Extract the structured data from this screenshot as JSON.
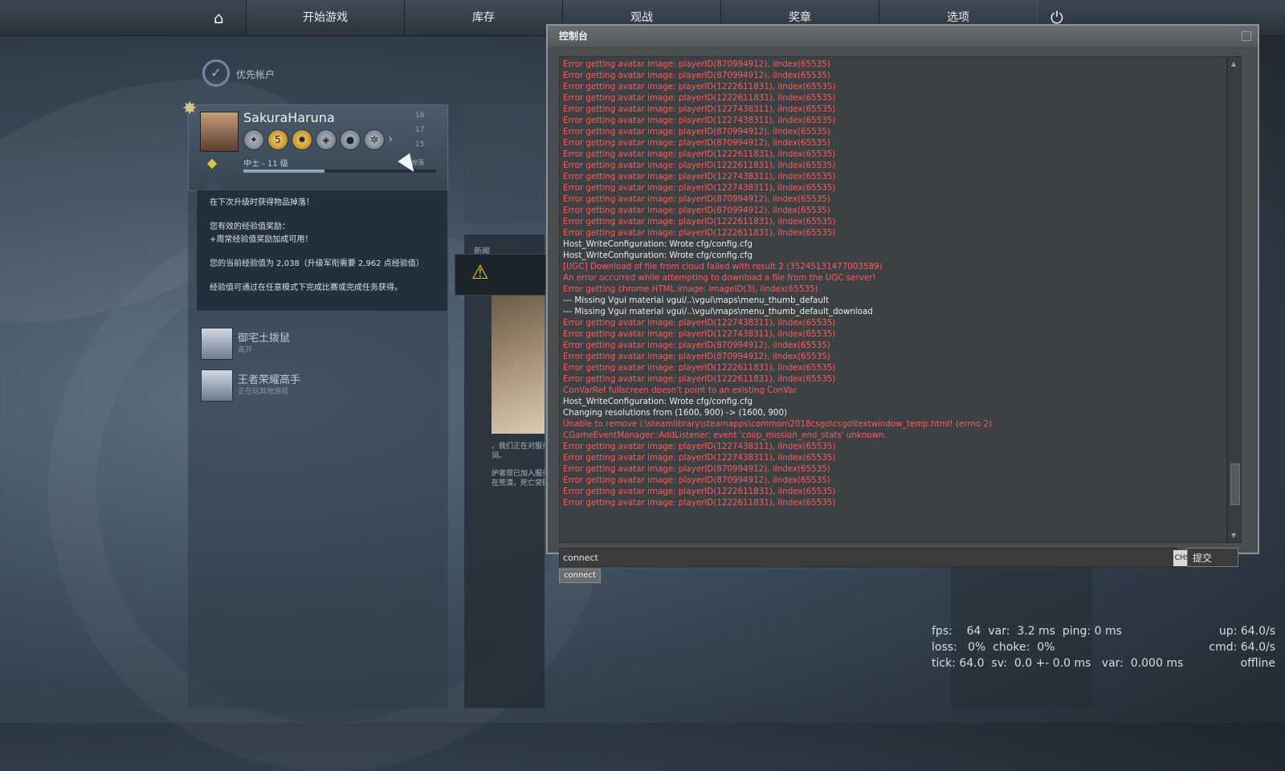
{
  "nav": {
    "items": [
      "开始游戏",
      "库存",
      "观战",
      "奖章",
      "选项"
    ]
  },
  "prime": {
    "label": "优先帐户"
  },
  "profile": {
    "username": "SakuraHaruna",
    "medal_number": "5",
    "stats": [
      "16",
      "17",
      "15"
    ],
    "rank": "中士 - 11 级",
    "xp_fraction": 0.42,
    "xp_right_label": "+ 掉落"
  },
  "tooltip": {
    "line1": "在下次升级时获得物品掉落！",
    "line2": "您有效的经验值奖励：",
    "line3": "+周常经验值奖励加成可用！",
    "line4": "您的当前经验值为 2,038（升级军衔需要 2,962 点经验值）",
    "line5": "经验值可通过在任意模式下完成比赛或完成任务获得。"
  },
  "friends": [
    {
      "name": "御宅土拨鼠",
      "status": "离开"
    },
    {
      "name": "王者荣耀高手",
      "status": "正在玩其他游戏"
    }
  ],
  "news": {
    "label": "新闻",
    "text1": "，我们正在对服务",
    "text2": "词。",
    "text3": "护者现已加入服务",
    "text4": "在荒漠，死亡突破"
  },
  "console": {
    "title": "控制台",
    "lines": [
      {
        "t": "Error getting avatar image: playerID(870994912), iIndex(65535)",
        "c": "red"
      },
      {
        "t": "Error getting avatar image: playerID(870994912), iIndex(65535)",
        "c": "red"
      },
      {
        "t": "Error getting avatar image: playerID(1222611831), iIndex(65535)",
        "c": "red"
      },
      {
        "t": "Error getting avatar image: playerID(1222611831), iIndex(65535)",
        "c": "red"
      },
      {
        "t": "Error getting avatar image: playerID(1227438311), iIndex(65535)",
        "c": "red"
      },
      {
        "t": "Error getting avatar image: playerID(1227438311), iIndex(65535)",
        "c": "red"
      },
      {
        "t": "Error getting avatar image: playerID(870994912), iIndex(65535)",
        "c": "red"
      },
      {
        "t": "Error getting avatar image: playerID(870994912), iIndex(65535)",
        "c": "red"
      },
      {
        "t": "Error getting avatar image: playerID(1222611831), iIndex(65535)",
        "c": "red"
      },
      {
        "t": "Error getting avatar image: playerID(1222611831), iIndex(65535)",
        "c": "red"
      },
      {
        "t": "Error getting avatar image: playerID(1227438311), iIndex(65535)",
        "c": "red"
      },
      {
        "t": "Error getting avatar image: playerID(1227438311), iIndex(65535)",
        "c": "red"
      },
      {
        "t": "Error getting avatar image: playerID(870994912), iIndex(65535)",
        "c": "red"
      },
      {
        "t": "Error getting avatar image: playerID(870994912), iIndex(65535)",
        "c": "red"
      },
      {
        "t": "Error getting avatar image: playerID(1222611831), iIndex(65535)",
        "c": "red"
      },
      {
        "t": "Error getting avatar image: playerID(1222611831), iIndex(65535)",
        "c": "red"
      },
      {
        "t": "Host_WriteConfiguration: Wrote cfg/config.cfg",
        "c": "white"
      },
      {
        "t": "Host_WriteConfiguration: Wrote cfg/config.cfg",
        "c": "white"
      },
      {
        "t": "[UGC] Download of file  from cloud failed with result 2 (35245131477003589)",
        "c": "red"
      },
      {
        "t": "An error occurred while attempting to download a file from the UGC server!",
        "c": "red"
      },
      {
        "t": "Error getting chrome HTML image: imageID(3), iIndex(65535)",
        "c": "red"
      },
      {
        "t": "--- Missing Vgui material vgui/..\\vgui\\maps\\menu_thumb_default",
        "c": "white"
      },
      {
        "t": "--- Missing Vgui material vgui/..\\vgui\\maps\\menu_thumb_default_download",
        "c": "white"
      },
      {
        "t": "Error getting avatar image: playerID(1227438311), iIndex(65535)",
        "c": "red"
      },
      {
        "t": "Error getting avatar image: playerID(1227438311), iIndex(65535)",
        "c": "red"
      },
      {
        "t": "Error getting avatar image: playerID(870994912), iIndex(65535)",
        "c": "red"
      },
      {
        "t": "Error getting avatar image: playerID(870994912), iIndex(65535)",
        "c": "red"
      },
      {
        "t": "Error getting avatar image: playerID(1222611831), iIndex(65535)",
        "c": "red"
      },
      {
        "t": "Error getting avatar image: playerID(1222611831), iIndex(65535)",
        "c": "red"
      },
      {
        "t": "ConVarRef fullscreen doesn't point to an existing ConVar",
        "c": "red"
      },
      {
        "t": "Host_WriteConfiguration: Wrote cfg/config.cfg",
        "c": "white"
      },
      {
        "t": "Changing resolutions from (1600, 900) -> (1600, 900)",
        "c": "white"
      },
      {
        "t": "Unable to remove i:\\steamlibrary\\steamapps\\common\\2018csgo\\csgo\\textwindow_temp.html! (errno 2)",
        "c": "red"
      },
      {
        "t": "CGameEventManager::AddListener: event 'coop_mission_end_stats' unknown.",
        "c": "red"
      },
      {
        "t": "Error getting avatar image: playerID(1227438311), iIndex(65535)",
        "c": "red"
      },
      {
        "t": "Error getting avatar image: playerID(1227438311), iIndex(65535)",
        "c": "red"
      },
      {
        "t": "Error getting avatar image: playerID(870994912), iIndex(65535)",
        "c": "red"
      },
      {
        "t": "Error getting avatar image: playerID(870994912), iIndex(65535)",
        "c": "red"
      },
      {
        "t": "Error getting avatar image: playerID(1222611831), iIndex(65535)",
        "c": "red"
      },
      {
        "t": "Error getting avatar image: playerID(1222611831), iIndex(65535)",
        "c": "red"
      }
    ],
    "input_value": "connect",
    "lang": "CHS",
    "submit_label": "提交",
    "suggestion": "connect"
  },
  "netgraph": {
    "row1": "fps:    64  var:  3.2 ms  ping: 0 ms",
    "row2": "loss:   0%  choke:  0%",
    "row3": "tick: 64.0  sv:  0.0 +- 0.0 ms   var:  0.000 ms",
    "right1": "up: 64.0/s",
    "right2": "cmd: 64.0/s",
    "right3": "offline"
  },
  "colors": {
    "error": "#ff5a5a",
    "normal": "#ececec",
    "accent": "#e0c24a"
  }
}
